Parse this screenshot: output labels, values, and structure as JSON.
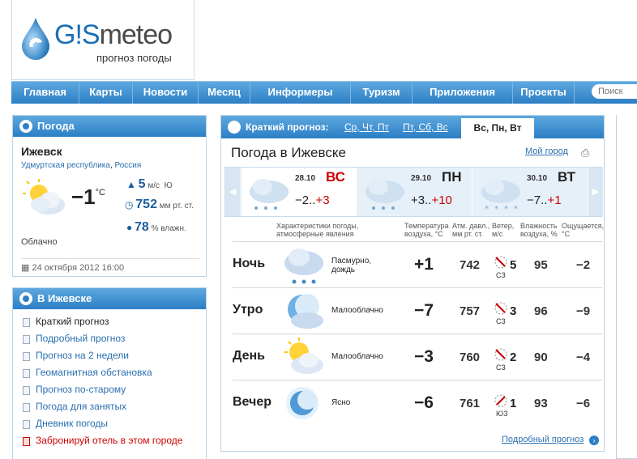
{
  "header": {
    "logo_prefix": "G!S",
    "logo_main": "meteo",
    "tagline": "прогноз погоды"
  },
  "nav": {
    "items": [
      "Главная",
      "Карты",
      "Новости",
      "Месяц",
      "Информеры",
      "Туризм",
      "Приложения",
      "Проекты"
    ],
    "search_placeholder": "Поиск"
  },
  "left_weather": {
    "title": "Погода",
    "city": "Ижевск",
    "region": "Удмуртская республика",
    "country": "Россия",
    "temp": "−1",
    "temp_unit": "°C",
    "wind_speed": "5",
    "wind_unit": "м/с",
    "wind_dir": "Ю",
    "pressure": "752",
    "pressure_unit": "мм рт. ст.",
    "humidity": "78",
    "humidity_unit": "% влажн.",
    "condition": "Облачно",
    "date": "24 октября 2012 16:00"
  },
  "city_panel": {
    "title": "В Ижевске",
    "links": [
      "Краткий прогноз",
      "Подробный прогноз",
      "Прогноз на 2 недели",
      "Геомагнитная обстановка",
      "Прогноз по-старому",
      "Погода для занятых",
      "Дневник погоды"
    ],
    "hotel_link": "Забронируй отель в этом городе"
  },
  "main": {
    "tab_label": "Краткий прогноз:",
    "tabs": [
      "Ср, Чт, Пт",
      "Пт, Сб, Вс"
    ],
    "active_tab": "Вс, Пн, Вт",
    "title": "Погода в Ижевске",
    "my_city": "Мой город",
    "days": [
      {
        "date": "28.10",
        "dow": "ВС",
        "lo": "−2",
        "hi": "+3",
        "weekend": true
      },
      {
        "date": "29.10",
        "dow": "ПН",
        "lo": "+3",
        "hi": "+10",
        "weekend": false
      },
      {
        "date": "30.10",
        "dow": "ВТ",
        "lo": "−7",
        "hi": "+1",
        "weekend": false
      }
    ],
    "headers": {
      "phenomena": "Характеристики погоды, атмосферные явления",
      "temp": "Температура воздуха, °C",
      "pressure": "Атм. давл., мм рт. ст.",
      "wind": "Ветер, м/с",
      "humidity": "Влажность воздуха, %",
      "feels": "Ощущается, °C"
    },
    "rows": [
      {
        "name": "Ночь",
        "desc": "Пасмурно, дождь",
        "temp": "+1",
        "pressure": "742",
        "wind": "5",
        "wind_dir": "СЗ",
        "humidity": "95",
        "feels": "−2",
        "icon": "rain-cloud-icon"
      },
      {
        "name": "Утро",
        "desc": "Малооблачно",
        "temp": "−7",
        "pressure": "757",
        "wind": "3",
        "wind_dir": "СЗ",
        "humidity": "96",
        "feels": "−9",
        "icon": "moon-cloud-icon"
      },
      {
        "name": "День",
        "desc": "Малооблачно",
        "temp": "−3",
        "pressure": "760",
        "wind": "2",
        "wind_dir": "СЗ",
        "humidity": "90",
        "feels": "−4",
        "icon": "sun-cloud-icon"
      },
      {
        "name": "Вечер",
        "desc": "Ясно",
        "temp": "−6",
        "pressure": "761",
        "wind": "1",
        "wind_dir": "ЮЗ",
        "humidity": "93",
        "feels": "−6",
        "icon": "moon-icon"
      }
    ],
    "detail_link": "Подробный прогноз"
  }
}
